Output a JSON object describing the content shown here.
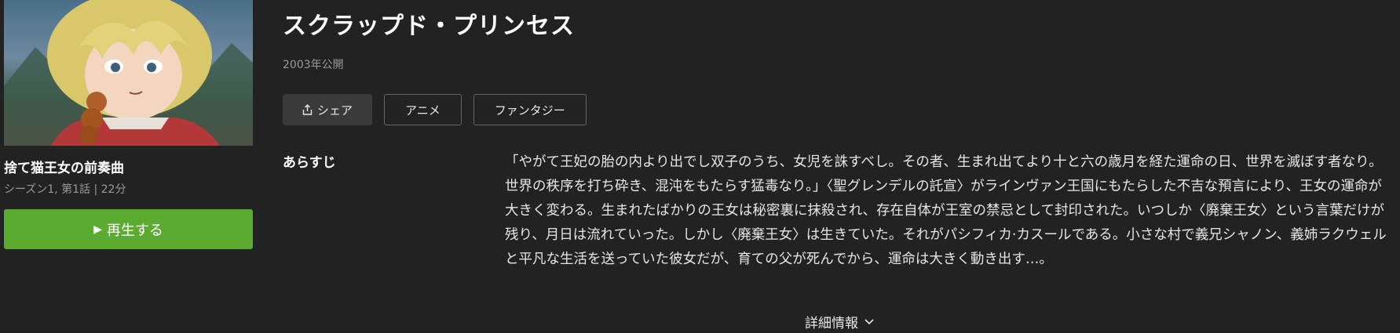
{
  "episode": {
    "title": "捨て猫王女の前奏曲",
    "meta": "シーズン1, 第1話 | 22分",
    "play_label": "再生する"
  },
  "series": {
    "title": "スクラップド・プリンセス",
    "year": "2003年公開",
    "share_label": "シェア",
    "tags": [
      "アニメ",
      "ファンタジー"
    ]
  },
  "synopsis": {
    "label": "あらすじ",
    "text": "「やがて王妃の胎の内より出でし双子のうち、女児を誅すべし。その者、生まれ出てより十と六の歳月を経た運命の日、世界を滅ぼす者なり。世界の秩序を打ち砕き、混沌をもたらす猛毒なり。」〈聖グレンデルの託宣〉がラインヴァン王国にもたらした不吉な預言により、王女の運命が大きく変わる。生まれたばかりの王女は秘密裏に抹殺され、存在自体が王室の禁忌として封印された。いつしか〈廃棄王女〉という言葉だけが残り、月日は流れていった。しかし〈廃棄王女〉は生きていた。それがパシフィカ·カスールである。小さな村で義兄シャノン、義姉ラクウェルと平凡な生活を送っていた彼女だが、育ての父が死んでから、運命は大きく動き出す…。"
  },
  "details_label": "詳細情報",
  "colors": {
    "background": "#222222",
    "play_button": "#5cab31",
    "muted_text": "#9a9a9a"
  }
}
